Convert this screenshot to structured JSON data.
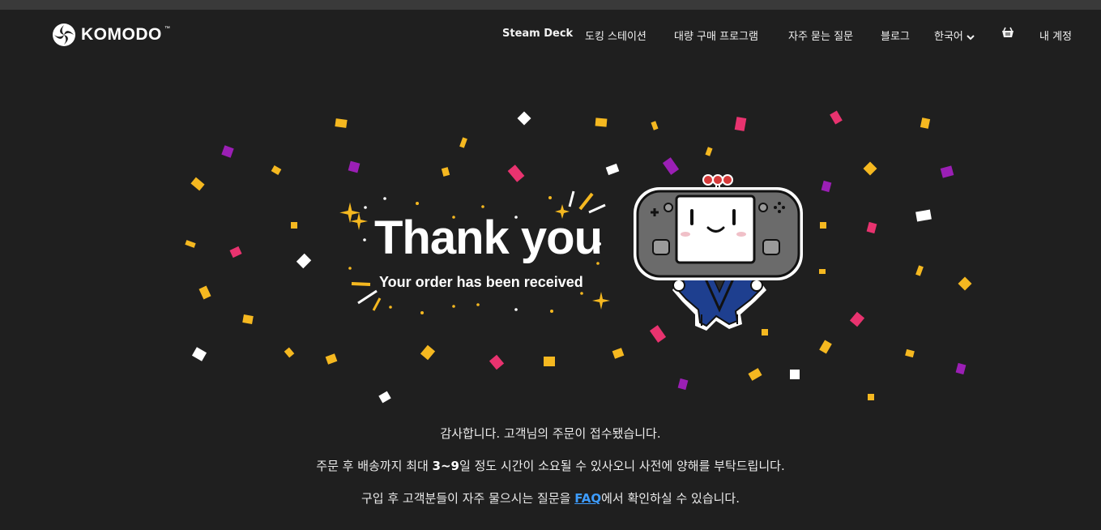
{
  "brand": {
    "name": "KOMODO",
    "tm": "™"
  },
  "nav": {
    "items": [
      "Steam Deck",
      "도킹 스테이션",
      "대량 구매 프로그램",
      "자주 묻는 질문",
      "블로그"
    ],
    "language": "한국어",
    "account": "내 계정"
  },
  "hero": {
    "title": "Thank you",
    "subtitle": "Your order has been received"
  },
  "message": {
    "line1": "감사합니다. 고객님의 주문이 접수됐습니다.",
    "line2_pre": "주문 후 배송까지 최대 ",
    "line2_bold": "3~9",
    "line2_post": "일 정도 시간이 소요될 수 있사오니 사전에 양해를 부탁드립니다.",
    "line3_pre": "구입 후 고객분들이 자주 물으시는 질문을 ",
    "line3_link": "FAQ",
    "line3_post": "에서 확인하실 수 있습니다."
  },
  "colors": {
    "background": "#1f1f1f",
    "link": "#3d9cff",
    "confetti_yellow": "#f5b820",
    "confetti_pink": "#e8336f",
    "confetti_purple": "#9b1fb5",
    "confetti_white": "#ffffff"
  },
  "icons": {
    "logo": "komodo-logo-icon",
    "cart": "shopping-basket-icon",
    "language_dropdown": "chevron-down-icon",
    "mascot": "game-console-mascot"
  }
}
